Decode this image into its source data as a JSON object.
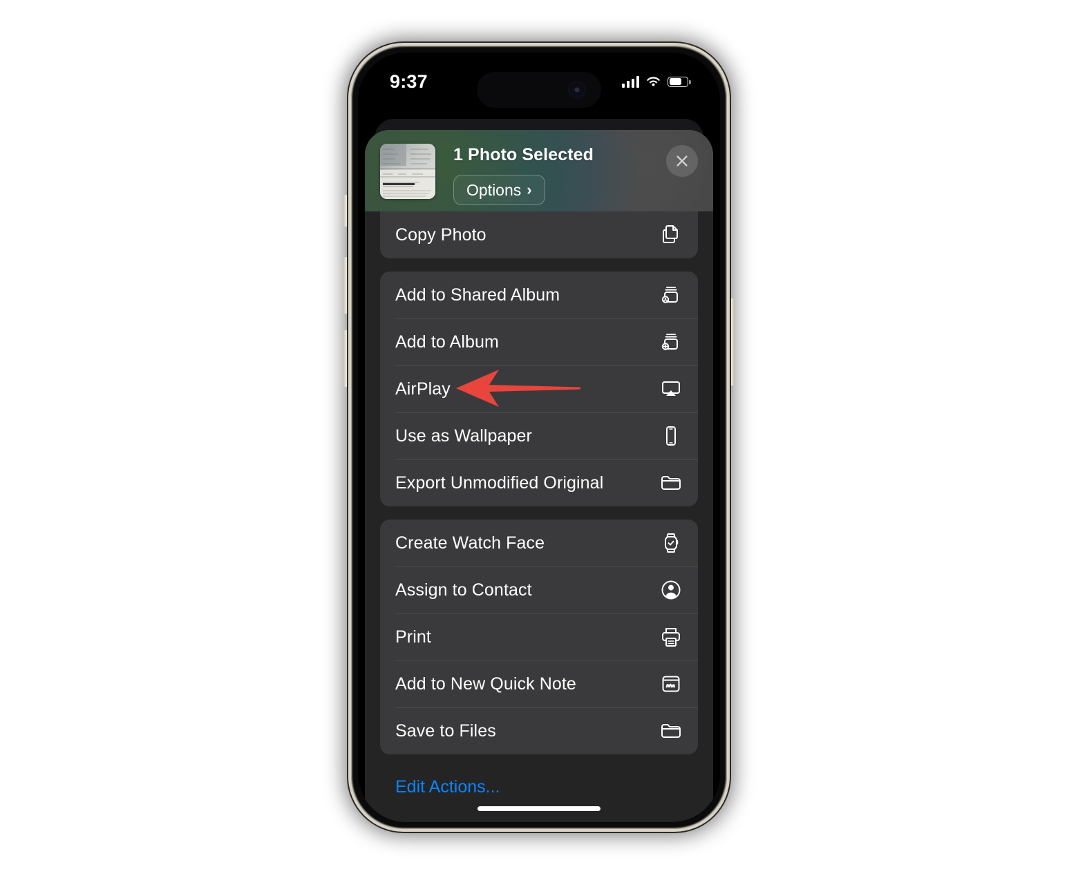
{
  "status_bar": {
    "time": "9:37",
    "cellular_icon": "cellular-bars-icon",
    "wifi_icon": "wifi-icon",
    "battery_icon": "battery-icon",
    "battery_level_percent": 62
  },
  "share_sheet": {
    "title": "1 Photo Selected",
    "options_label": "Options",
    "options_chevron": "›",
    "close_icon": "close-icon",
    "thumbnail_alt": "photo-of-document-thumbnail",
    "groups": [
      {
        "clipped": true,
        "items": [
          {
            "label": "Copy Photo",
            "icon": "copy-documents-icon"
          }
        ]
      },
      {
        "clipped": false,
        "items": [
          {
            "label": "Add to Shared Album",
            "icon": "shared-album-icon"
          },
          {
            "label": "Add to Album",
            "icon": "add-to-album-icon"
          },
          {
            "label": "AirPlay",
            "icon": "airplay-icon"
          },
          {
            "label": "Use as Wallpaper",
            "icon": "iphone-icon"
          },
          {
            "label": "Export Unmodified Original",
            "icon": "folder-icon"
          }
        ]
      },
      {
        "clipped": false,
        "items": [
          {
            "label": "Create Watch Face",
            "icon": "apple-watch-icon"
          },
          {
            "label": "Assign to Contact",
            "icon": "person-circle-icon"
          },
          {
            "label": "Print",
            "icon": "printer-icon"
          },
          {
            "label": "Add to New Quick Note",
            "icon": "quick-note-icon"
          },
          {
            "label": "Save to Files",
            "icon": "folder-icon"
          }
        ]
      }
    ],
    "edit_actions_label": "Edit Actions..."
  },
  "annotation": {
    "arrow_color": "#e8453c",
    "points_to": "Print"
  },
  "colors": {
    "sheet_background": "#242424",
    "row_background": "#3a3a3c",
    "accent_blue": "#0a84ff",
    "text_primary": "#ffffff",
    "frame_titanium": "#d8d3c4"
  }
}
